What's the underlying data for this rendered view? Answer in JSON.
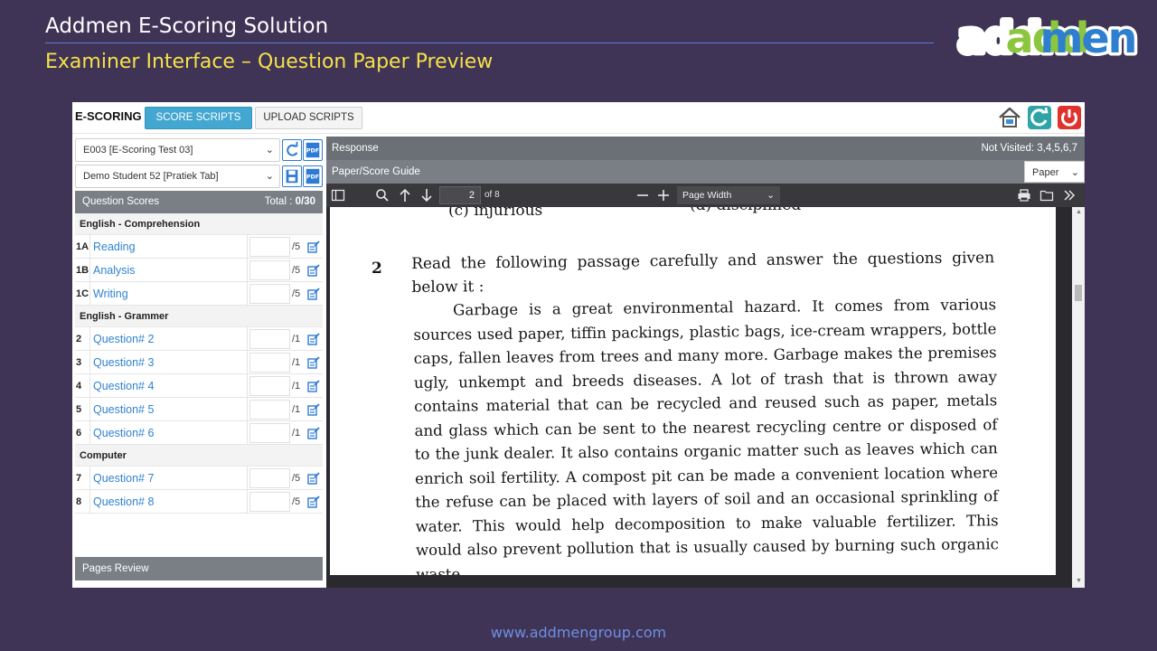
{
  "slide": {
    "title": "Addmen E-Scoring Solution",
    "subtitle": "Examiner Interface – Question Paper Preview",
    "logo_text": "addmen",
    "footer_url": "www.addmengroup.com"
  },
  "topbar": {
    "brand": "E-SCORING",
    "score_scripts": "SCORE SCRIPTS",
    "upload_scripts": "UPLOAD SCRIPTS",
    "icons": [
      "home-icon",
      "refresh-icon",
      "power-icon"
    ]
  },
  "left": {
    "exam_select": "E003 [E-Scoring Test 03]",
    "student_select": "Demo Student 52 [Pratiek Tab]",
    "question_scores_label": "Question Scores",
    "total_label": "Total : ",
    "total_value": "0/30",
    "sections": [
      {
        "name": "English - Comprehension",
        "questions": [
          {
            "num": "1A",
            "name": "Reading",
            "max": "/5"
          },
          {
            "num": "1B",
            "name": "Analysis",
            "max": "/5"
          },
          {
            "num": "1C",
            "name": "Writing",
            "max": "/5"
          }
        ]
      },
      {
        "name": "English - Grammer",
        "questions": [
          {
            "num": "2",
            "name": "Question# 2",
            "max": "/1"
          },
          {
            "num": "3",
            "name": "Question# 3",
            "max": "/1"
          },
          {
            "num": "4",
            "name": "Question# 4",
            "max": "/1"
          },
          {
            "num": "5",
            "name": "Question# 5",
            "max": "/1"
          },
          {
            "num": "6",
            "name": "Question# 6",
            "max": "/1"
          }
        ]
      },
      {
        "name": "Computer",
        "questions": [
          {
            "num": "7",
            "name": "Question# 7",
            "max": "/5"
          },
          {
            "num": "8",
            "name": "Question# 8",
            "max": "/5"
          }
        ]
      }
    ],
    "pages_review": "Pages Review"
  },
  "right": {
    "response_label": "Response",
    "not_visited": "Not Visited: 3,4,5,6,7",
    "guide_label": "Paper/Score Guide",
    "paper_select": "Paper",
    "pdf": {
      "page_number": "2",
      "page_total": "of 8",
      "zoom": "Page Width"
    },
    "document": {
      "prev_c": "(c)   injurious",
      "prev_d": "(d)   disciplined",
      "question_number": "2",
      "question_lead": "Read the following passage carefully and answer the questions given below it :",
      "passage": "Garbage is a great environmental hazard. It comes from various sources used paper, tiffin packings, plastic bags, ice-cream wrappers, bottle caps, fallen leaves from trees and many more. Garbage makes the premises ugly, unkempt and breeds diseases. A lot of trash that is thrown away contains material that can be recycled and reused such as paper, metals and glass which can be sent to the nearest recycling centre or disposed of to the junk dealer. It also contains organic matter such as leaves which can enrich soil fertility. A compost pit can be made a convenient location where the refuse can be placed with layers of soil and an occasional sprinkling of water. This would help decomposition to make valuable fertilizer. This would also prevent pollution that is usually caused by burning such organic waste."
    }
  },
  "colors": {
    "background": "#3f3356",
    "subtitle": "#f6e04a",
    "primary_button": "#43a7d1",
    "link": "#3183cf",
    "panel_header": "#7a7f86"
  }
}
